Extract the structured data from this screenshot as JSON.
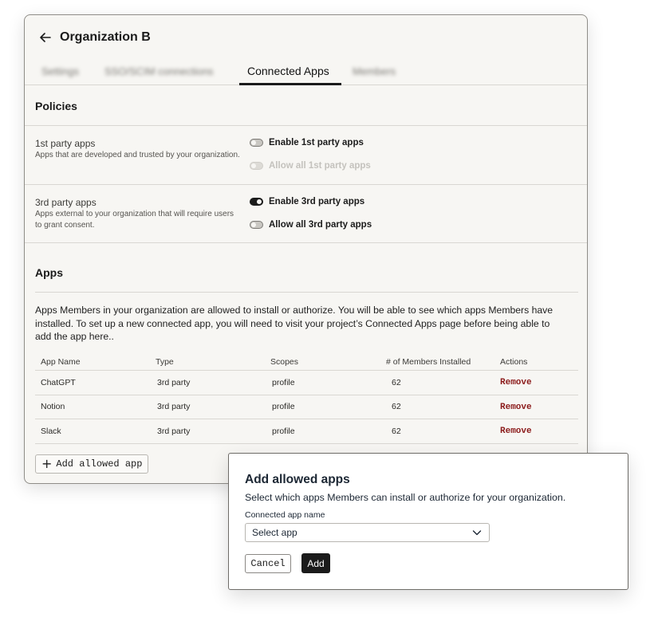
{
  "window": {
    "title": "Organization B"
  },
  "tabs": [
    {
      "label": "Settings",
      "active": false,
      "blurred": true
    },
    {
      "label": "SSO/SCIM connections",
      "active": false,
      "blurred": true
    },
    {
      "label": "Connected Apps",
      "active": true,
      "blurred": false
    },
    {
      "label": "Members",
      "active": false,
      "blurred": true
    }
  ],
  "policies": {
    "title": "Policies",
    "first_party": {
      "name": "1st party apps",
      "description": "Apps that are developed and trusted by your organization.",
      "toggles": [
        {
          "label": "Enable 1st party apps",
          "state": "off",
          "disabled": false
        },
        {
          "label": "Allow all 1st party apps",
          "state": "off",
          "disabled": true
        }
      ]
    },
    "third_party": {
      "name": "3rd party apps",
      "description": "Apps external to your organization that will require users to grant consent.",
      "toggles": [
        {
          "label": "Enable 3rd party apps",
          "state": "on",
          "disabled": false
        },
        {
          "label": "Allow all 3rd party apps",
          "state": "off",
          "disabled": false
        }
      ]
    }
  },
  "apps": {
    "title": "Apps",
    "description": "Apps Members in your organization are allowed to install or authorize. You will be able to see which apps Members have installed. To set up a new connected app, you will need to visit your project’s Connected Apps page before being able to add the app here..",
    "columns": [
      "App Name",
      "Type",
      "Scopes",
      "# of Members Installed",
      "Actions"
    ],
    "rows": [
      {
        "name": "ChatGPT",
        "type": "3rd party",
        "scopes": "profile",
        "members": "62",
        "action": "Remove"
      },
      {
        "name": "Notion",
        "type": "3rd party",
        "scopes": "profile",
        "members": "62",
        "action": "Remove"
      },
      {
        "name": "Slack",
        "type": "3rd party",
        "scopes": "profile",
        "members": "62",
        "action": "Remove"
      }
    ],
    "add_button": "Add allowed app"
  },
  "modal": {
    "title": "Add allowed apps",
    "subtitle": "Select which apps Members can install or authorize for your organization.",
    "field_label": "Connected app name",
    "select_placeholder": "Select app",
    "cancel_label": "Cancel",
    "add_label": "Add"
  },
  "colors": {
    "panel_bg": "#f7f6f3",
    "remove_red": "#8b1a1a",
    "primary_dark": "#1b1b1b"
  }
}
